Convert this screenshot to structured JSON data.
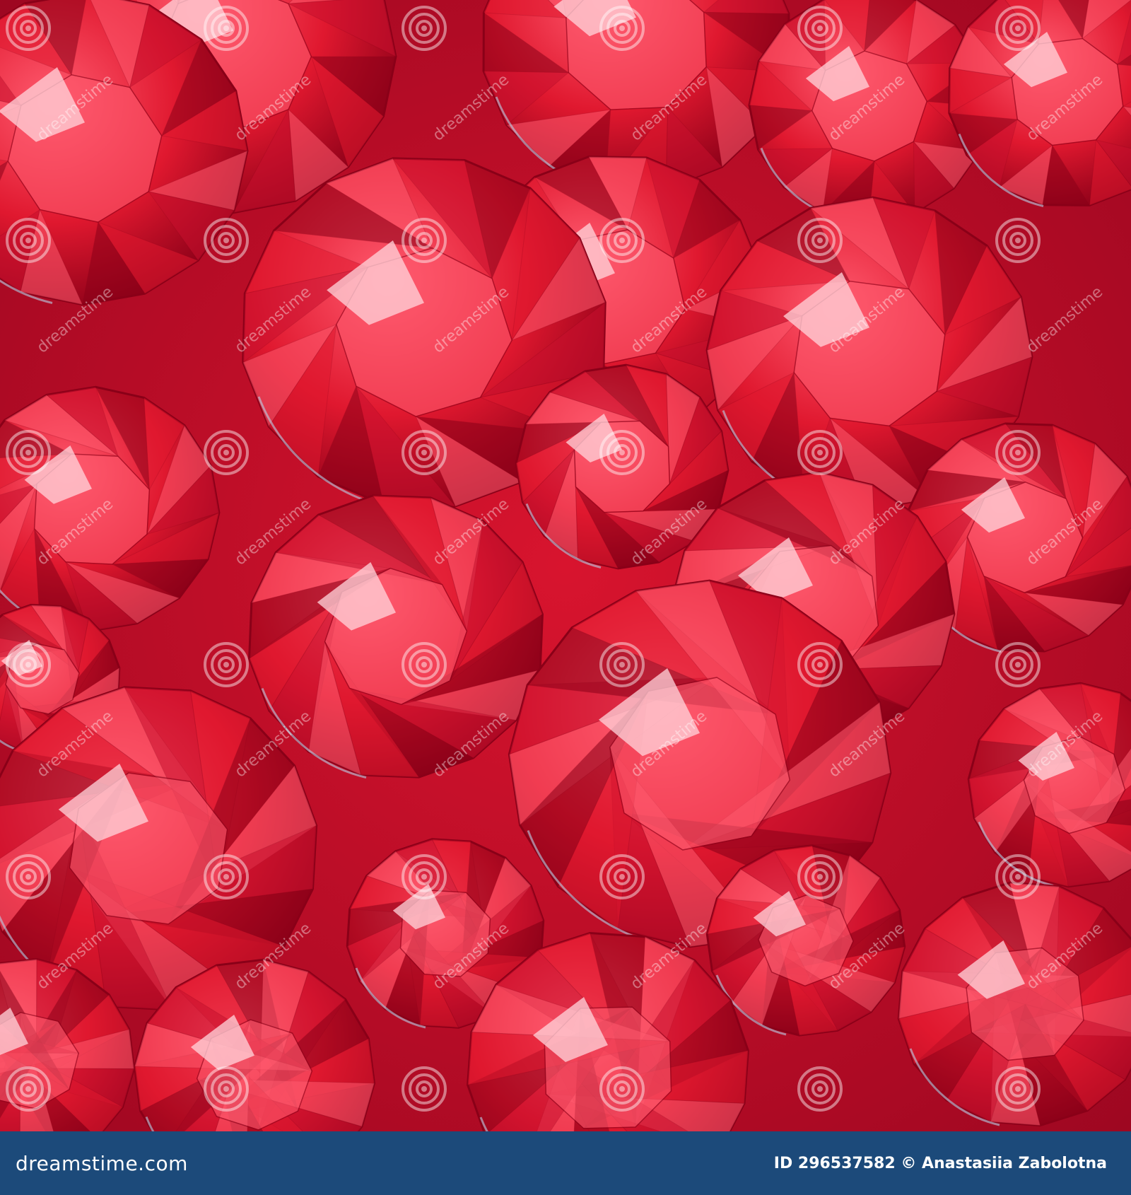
{
  "photo": {
    "subject_icon": "red-gemstones-image",
    "colors": {
      "base": "#c8102e",
      "deep": "#8a0018",
      "mid": "#e0182f",
      "light": "#ff5a6e",
      "highlight": "#ffd6dc",
      "edge_tint": "#b8d0e8"
    }
  },
  "watermark": {
    "icon": "spiral-watermark-icon",
    "text": "dreamstime"
  },
  "footer": {
    "background": "#1c4a7a",
    "brand": "dreamstime.com",
    "credit": "ID 296537582 © Anastasiia Zabolotna"
  }
}
